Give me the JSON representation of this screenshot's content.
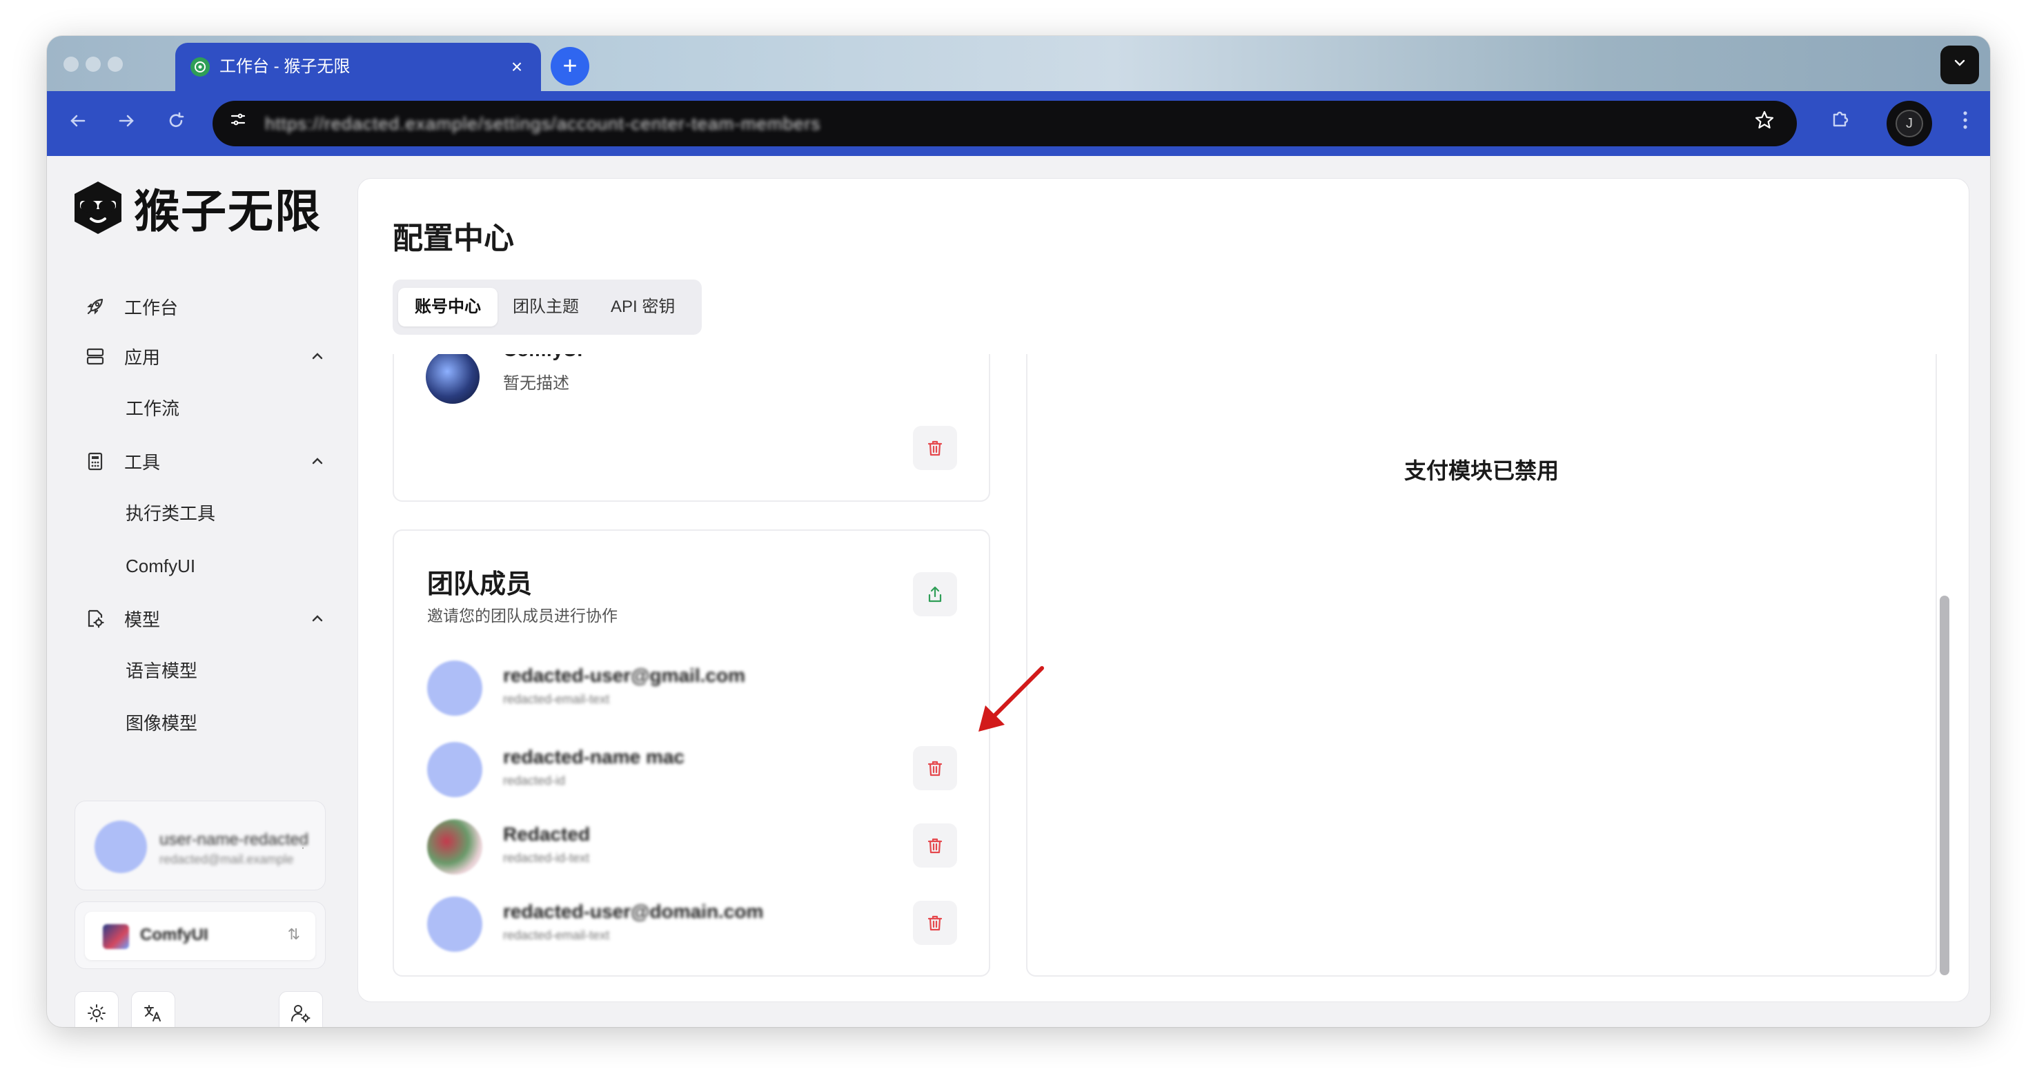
{
  "browser": {
    "tab_title": "工作台 - 猴子无限",
    "close_glyph": "×",
    "new_tab_glyph": "+",
    "url": "https://redacted.example/settings/account-center-team-members"
  },
  "sidebar": {
    "brand": "猴子无限",
    "items": [
      {
        "label": "工作台"
      },
      {
        "label": "应用"
      },
      {
        "label": "工作流"
      },
      {
        "label": "工具"
      },
      {
        "label": "执行类工具"
      },
      {
        "label": "ComfyUI"
      },
      {
        "label": "模型"
      },
      {
        "label": "语言模型"
      },
      {
        "label": "图像模型"
      }
    ],
    "user": {
      "name": "user-name-redacted",
      "email": "redacted@mail.example"
    },
    "team": {
      "name": "ComfyUI",
      "switch_glyph": "⇅"
    }
  },
  "main": {
    "title": "配置中心",
    "tabs": [
      "账号中心",
      "团队主题",
      "API 密钥"
    ],
    "team_card": {
      "name": "ComfyUI",
      "description": "暂无描述"
    },
    "members_card": {
      "title": "团队成员",
      "subtitle": "邀请您的团队成员进行协作",
      "members": [
        {
          "name": "redacted-user@gmail.com",
          "sub": "redacted-email-text",
          "avatar": "default",
          "deletable": false
        },
        {
          "name": "redacted-name mac",
          "sub": "redacted-id",
          "avatar": "default",
          "deletable": true
        },
        {
          "name": "Redacted",
          "sub": "redacted-id-text",
          "avatar": "photo",
          "deletable": true
        },
        {
          "name": "redacted-user@domain.com",
          "sub": "redacted-email-text",
          "avatar": "default",
          "deletable": true
        }
      ]
    },
    "payment_panel": {
      "message": "支付模块已禁用"
    }
  },
  "colors": {
    "browser_accent": "#2f4fc4",
    "danger": "#e5484d",
    "success": "#2f9e57",
    "avatar_default": "#aebef7"
  },
  "icons": {
    "nav": [
      "rocket-icon",
      "app-stack-icon",
      "calculator-icon",
      "model-gear-icon"
    ],
    "bottom": [
      "sun-icon",
      "translate-icon",
      "user-settings-icon"
    ]
  }
}
